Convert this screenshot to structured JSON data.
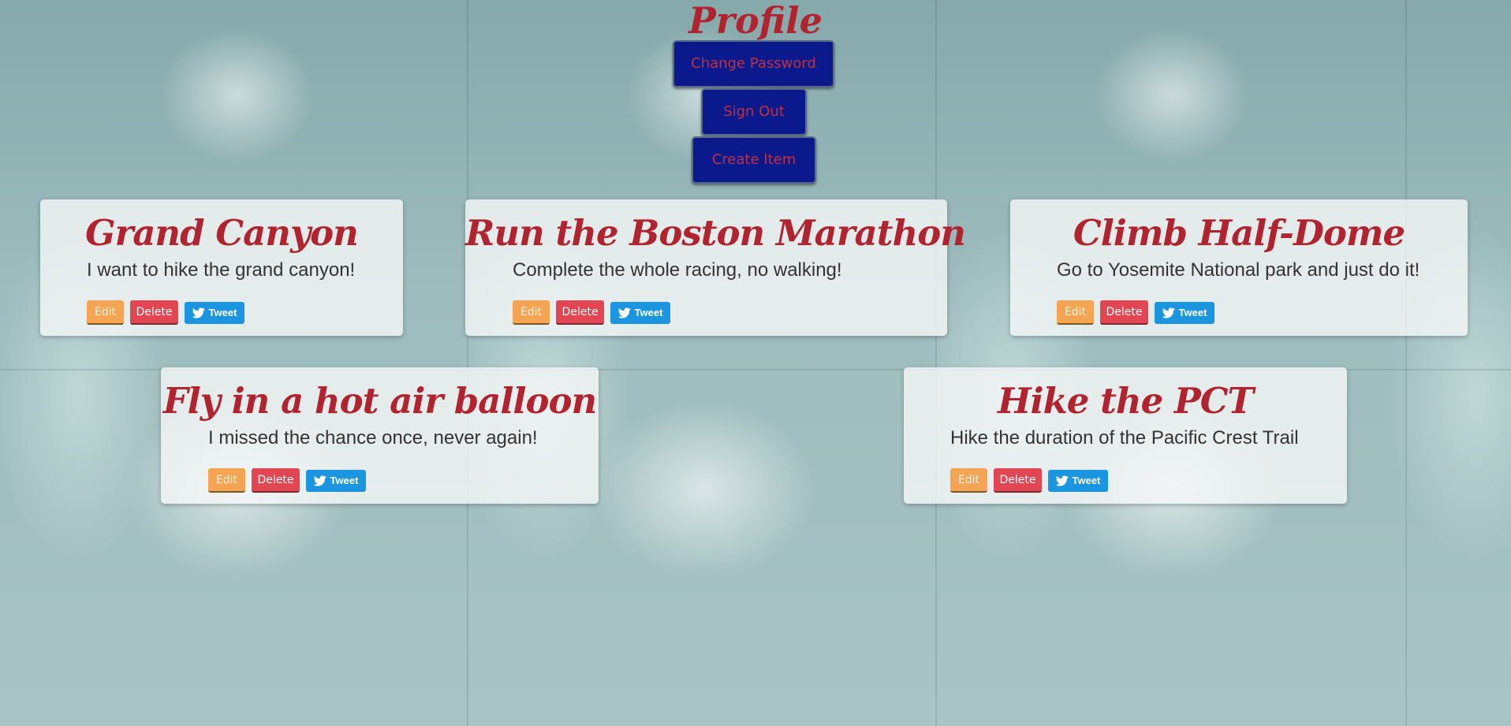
{
  "header": {
    "title": "Profile",
    "buttons": {
      "change_password": "Change Password",
      "sign_out": "Sign Out",
      "create_item": "Create Item"
    }
  },
  "actions": {
    "edit": "Edit",
    "delete": "Delete",
    "tweet": "Tweet"
  },
  "items": [
    {
      "title": "Grand Canyon",
      "description": "I want to hike the grand canyon!"
    },
    {
      "title": "Run the Boston Marathon",
      "description": "Complete the whole racing, no walking!"
    },
    {
      "title": "Climb Half-Dome",
      "description": "Go to Yosemite National park and just do it!"
    },
    {
      "title": "Fly in a hot air balloon",
      "description": "I missed the chance once, never again!"
    },
    {
      "title": "Hike the PCT",
      "description": "Hike the duration of the Pacific Crest Trail"
    }
  ],
  "icons": {
    "tweet": "twitter-bird-icon"
  },
  "colors": {
    "title_red": "#b0232f",
    "nav_button_bg": "#0a1a8c",
    "edit_orange": "#f5a454",
    "delete_red": "#e24652",
    "tweet_blue": "#1b95e0"
  }
}
